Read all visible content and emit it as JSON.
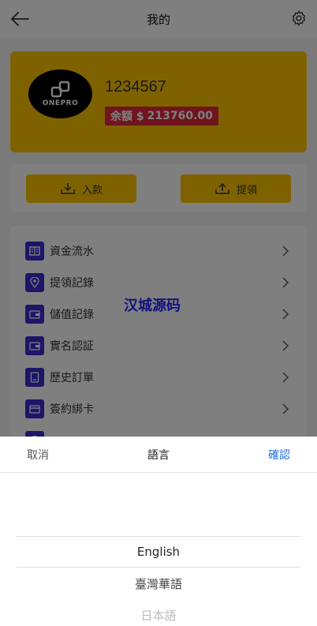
{
  "header": {
    "title": "我的",
    "back_icon": "arrow-left-icon",
    "settings_icon": "gear-icon"
  },
  "profile": {
    "username": "1234567",
    "avatar_logo": "ONEPRO",
    "balance_label": "余額 $",
    "balance_value": "213760.00",
    "card_color": "#ffc400",
    "badge_color": "#e0283a"
  },
  "actions": {
    "deposit": {
      "label": "入款",
      "icon": "download-tray-icon"
    },
    "withdraw": {
      "label": "提領",
      "icon": "upload-tray-icon"
    }
  },
  "menu": {
    "items": [
      {
        "label": "資金流水",
        "icon": "book-icon"
      },
      {
        "label": "提領記錄",
        "icon": "location-pin-icon"
      },
      {
        "label": "儲值記錄",
        "icon": "wallet-icon"
      },
      {
        "label": "實名認証",
        "icon": "id-card-icon"
      },
      {
        "label": "歷史訂單",
        "icon": "document-icon"
      },
      {
        "label": "簽約綁卡",
        "icon": "bank-card-icon"
      }
    ],
    "icon_color": "#3a2bd0"
  },
  "watermark": {
    "text": "汉城源码",
    "color": "#2222ff"
  },
  "language_sheet": {
    "cancel_label": "取消",
    "title": "語言",
    "confirm_label": "確認",
    "confirm_color": "#1f6fd8",
    "options": [
      "English",
      "臺灣華語",
      "日本語"
    ],
    "selected": "English"
  }
}
